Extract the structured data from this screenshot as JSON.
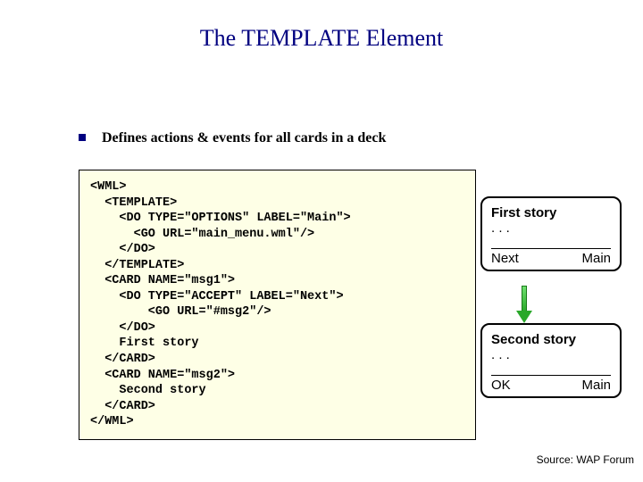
{
  "title": "The TEMPLATE Element",
  "bullet": "Defines actions & events for all cards in a deck",
  "code": "<WML>\n  <TEMPLATE>\n    <DO TYPE=\"OPTIONS\" LABEL=\"Main\">\n      <GO URL=\"main_menu.wml\"/>\n    </DO>\n  </TEMPLATE>\n  <CARD NAME=\"msg1\">\n    <DO TYPE=\"ACCEPT\" LABEL=\"Next\">\n        <GO URL=\"#msg2\"/>\n    </DO>\n    First story\n  </CARD>\n  <CARD NAME=\"msg2\">\n    Second story\n  </CARD>\n</WML>",
  "cards": [
    {
      "title": "First story",
      "ellipsis": ". . .",
      "left": "Next",
      "right": "Main"
    },
    {
      "title": "Second story",
      "ellipsis": ". . .",
      "left": "OK",
      "right": "Main"
    }
  ],
  "source": "Source: WAP Forum"
}
